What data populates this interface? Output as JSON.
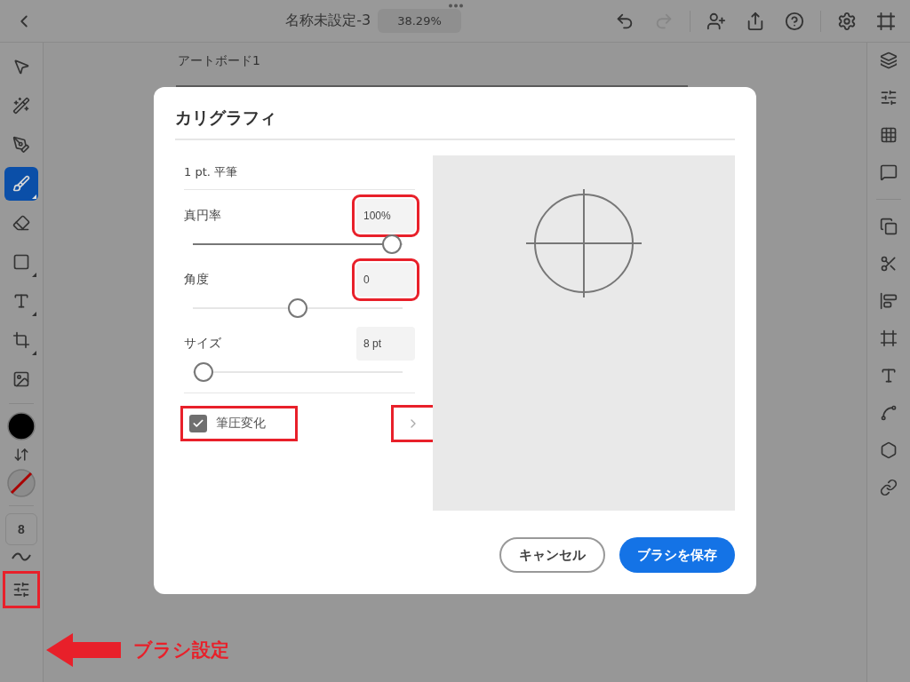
{
  "top_bar": {
    "title": "名称未設定-3",
    "zoom": "38.29%",
    "actions": [
      {
        "disabled": false
      },
      {
        "disabled": true
      },
      {
        "disabled": false
      },
      {
        "disabled": false
      },
      {
        "disabled": false
      },
      {
        "disabled": false
      },
      {
        "disabled": false
      }
    ]
  },
  "left_tools": [
    {
      "selected": false
    },
    {
      "selected": false
    },
    {
      "selected": false
    },
    {
      "selected": true
    },
    {
      "selected": false
    },
    {
      "selected": false
    },
    {
      "selected": false
    },
    {
      "selected": false
    },
    {
      "selected": false
    }
  ],
  "stroke_size": "8",
  "brush_settings": {
    "highlighted": true
  },
  "artboard": {
    "label": "アートボード1"
  },
  "dialog": {
    "title": "カリグラフィ",
    "brush_name": "1 pt. 平筆",
    "settings": [
      {
        "label": "真円率",
        "value": "100%",
        "level": 0.95,
        "filled": true,
        "highlighted": true
      },
      {
        "label": "角度",
        "value": "0",
        "level": 0.5,
        "filled": false,
        "highlighted": true
      },
      {
        "label": "サイズ",
        "value": "8 pt",
        "level": 0.05,
        "filled": false,
        "highlighted": false
      }
    ],
    "pressure": {
      "label": "筆圧変化",
      "checked": true,
      "highlighted": true
    },
    "more": {
      "highlighted": true
    },
    "cancel": "キャンセル",
    "save": "ブラシを保存"
  },
  "annotation": {
    "label": "ブラシ設定"
  }
}
